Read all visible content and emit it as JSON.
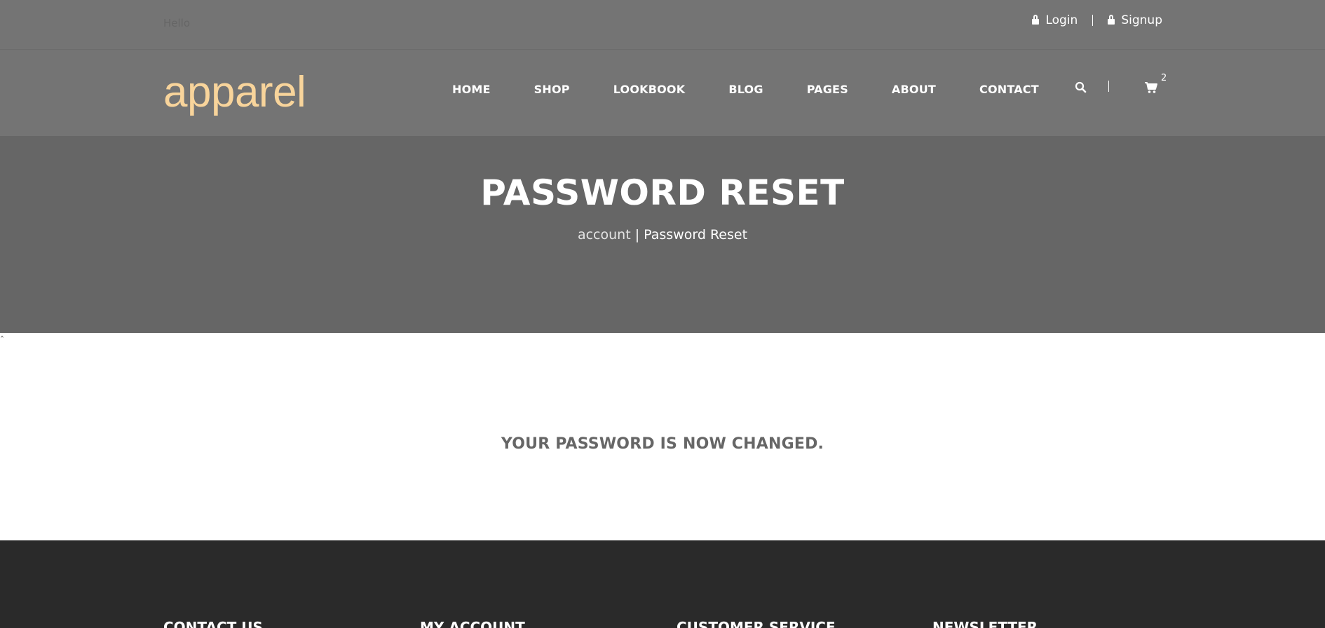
{
  "topbar": {
    "greeting": "Hello",
    "login_label": "Login",
    "signup_label": "Signup"
  },
  "header": {
    "logo": "apparel",
    "nav": [
      "HOME",
      "SHOP",
      "LOOKBOOK",
      "BLOG",
      "PAGES",
      "ABOUT",
      "CONTACT"
    ],
    "cart_count": "2",
    "search_icon": "search-icon",
    "cart_icon": "shopping-cart-icon"
  },
  "hero": {
    "title": "PASSWORD RESET",
    "breadcrumb_link": "account",
    "breadcrumb_sep": " | ",
    "breadcrumb_current": "Password Reset"
  },
  "main": {
    "cursor_char": "ˆ",
    "message": "YOUR PASSWORD IS NOW CHANGED."
  },
  "footer": {
    "headings": [
      "CONTACT US",
      "MY ACCOUNT",
      "CUSTOMER SERVICE",
      "NEWSLETTER"
    ]
  },
  "colors": {
    "topbar_bg": "#747474",
    "hero_bg": "#666666",
    "logo": "#f8d49b",
    "footer_bg": "#2a2a2a",
    "message_text": "#666666"
  }
}
